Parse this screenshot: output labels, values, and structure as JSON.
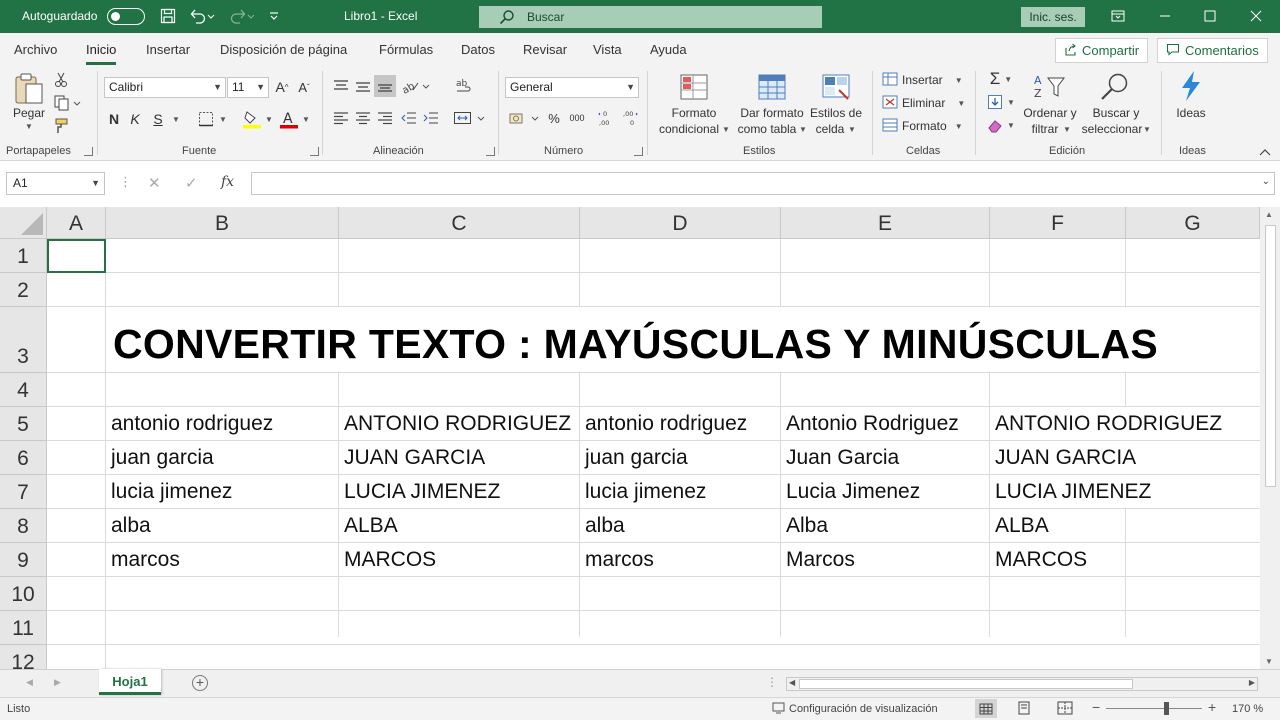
{
  "titlebar": {
    "autosave_label": "Autoguardado",
    "document_title": "Libro1  -  Excel",
    "search_placeholder": "Buscar",
    "signin_label": "Inic. ses.",
    "accent": "#217346"
  },
  "menu": {
    "items": [
      "Archivo",
      "Inicio",
      "Insertar",
      "Disposición de página",
      "Fórmulas",
      "Datos",
      "Revisar",
      "Vista",
      "Ayuda"
    ],
    "active": "Inicio",
    "share_label": "Compartir",
    "comments_label": "Comentarios"
  },
  "ribbon": {
    "portapapeles": {
      "label": "Portapapeles",
      "paste_label": "Pegar"
    },
    "fuente": {
      "label": "Fuente",
      "font_name": "Calibri",
      "font_size": "11",
      "bold": "N",
      "italic": "K",
      "underline": "S"
    },
    "alineacion": {
      "label": "Alineación"
    },
    "numero": {
      "label": "Número",
      "format": "General"
    },
    "estilos": {
      "label": "Estilos",
      "cond_format_1": "Formato",
      "cond_format_2": "condicional",
      "table_format_1": "Dar formato",
      "table_format_2": "como tabla",
      "cell_styles_1": "Estilos de",
      "cell_styles_2": "celda"
    },
    "celdas": {
      "label": "Celdas",
      "insert": "Insertar",
      "delete": "Eliminar",
      "format": "Formato"
    },
    "edicion": {
      "label": "Edición",
      "sort_1": "Ordenar y",
      "sort_2": "filtrar",
      "find_1": "Buscar y",
      "find_2": "seleccionar"
    },
    "ideas": {
      "label": "Ideas",
      "button": "Ideas"
    }
  },
  "formula_bar": {
    "name_box": "A1",
    "fx_symbol": "fx",
    "content": ""
  },
  "grid": {
    "columns": [
      "A",
      "B",
      "C",
      "D",
      "E",
      "F",
      "G"
    ],
    "rows": [
      "1",
      "2",
      "3",
      "4",
      "5",
      "6",
      "7",
      "8",
      "9",
      "10",
      "11",
      "12"
    ],
    "title": "CONVERTIR TEXTO : MAYÚSCULAS Y MINÚSCULAS",
    "data": [
      [
        "antonio rodriguez",
        "ANTONIO RODRIGUEZ",
        "antonio rodriguez",
        "Antonio Rodriguez",
        "ANTONIO RODRIGUEZ"
      ],
      [
        "juan garcia",
        "JUAN GARCIA",
        "juan garcia",
        "Juan Garcia",
        "JUAN GARCIA"
      ],
      [
        "lucia jimenez",
        "LUCIA JIMENEZ",
        "lucia jimenez",
        "Lucia Jimenez",
        "LUCIA JIMENEZ"
      ],
      [
        "alba",
        "ALBA",
        "alba",
        "Alba",
        "ALBA"
      ],
      [
        "marcos",
        "MARCOS",
        "marcos",
        "Marcos",
        "MARCOS"
      ]
    ]
  },
  "sheets": {
    "active": "Hoja1"
  },
  "statusbar": {
    "status": "Listo",
    "display_settings": "Configuración de visualización",
    "zoom": "170 %",
    "zoom_fraction": 0.62
  }
}
